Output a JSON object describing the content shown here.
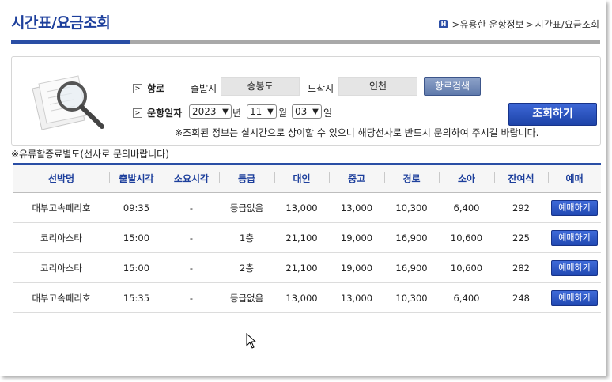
{
  "page": {
    "title": "시간표/요금조회",
    "breadcrumb": {
      "home_icon": "H",
      "items": [
        ">유용한 운항정보",
        ">",
        "시간표/요금조회"
      ]
    }
  },
  "search": {
    "route_label": "항로",
    "departure_label": "출발지",
    "departure_value": "송봉도",
    "arrival_label": "도착지",
    "arrival_value": "인천",
    "route_search_button": "항로검색",
    "date_label": "운항일자",
    "year": "2023",
    "year_unit": "년",
    "month": "11",
    "month_unit": "월",
    "day": "03",
    "day_unit": "일",
    "inquiry_button": "조회하기",
    "notice": "※조회된 정보는 실시간으로 상이할 수 있으니 해당선사로 반드시 문의하여 주시길 바랍니다."
  },
  "fare_note": "※유류할증료별도(선사로 문의바랍니다)",
  "table": {
    "headers": [
      "선박명",
      "출발시각",
      "소요시각",
      "등급",
      "대인",
      "중고",
      "경로",
      "소아",
      "잔여석",
      "예매"
    ],
    "rows": [
      {
        "ship": "대부고속페리호",
        "departure": "09:35",
        "duration": "-",
        "grade": "등급없음",
        "adult": "13,000",
        "student": "13,000",
        "senior": "10,300",
        "child": "6,400",
        "seats": "292",
        "book": "예매하기"
      },
      {
        "ship": "코리아스타",
        "departure": "15:00",
        "duration": "-",
        "grade": "1층",
        "adult": "21,100",
        "student": "19,000",
        "senior": "16,900",
        "child": "10,600",
        "seats": "225",
        "book": "예매하기"
      },
      {
        "ship": "코리아스타",
        "departure": "15:00",
        "duration": "-",
        "grade": "2층",
        "adult": "21,100",
        "student": "19,000",
        "senior": "16,900",
        "child": "10,600",
        "seats": "282",
        "book": "예매하기"
      },
      {
        "ship": "대부고속페리호",
        "departure": "15:35",
        "duration": "-",
        "grade": "등급없음",
        "adult": "13,000",
        "student": "13,000",
        "senior": "10,300",
        "child": "6,400",
        "seats": "248",
        "book": "예매하기"
      }
    ]
  },
  "icons": {
    "search_illustration": "magnifier-on-documents-icon",
    "row_marker": "chevron-right-icon",
    "select_arrow": "chevron-down-icon",
    "pointer": "mouse-cursor-icon"
  },
  "colors": {
    "accent": "#1d3f9c",
    "button_blue": "#2149b3",
    "route_button": "#6b84b5",
    "field_gray": "#e5e5e5"
  }
}
